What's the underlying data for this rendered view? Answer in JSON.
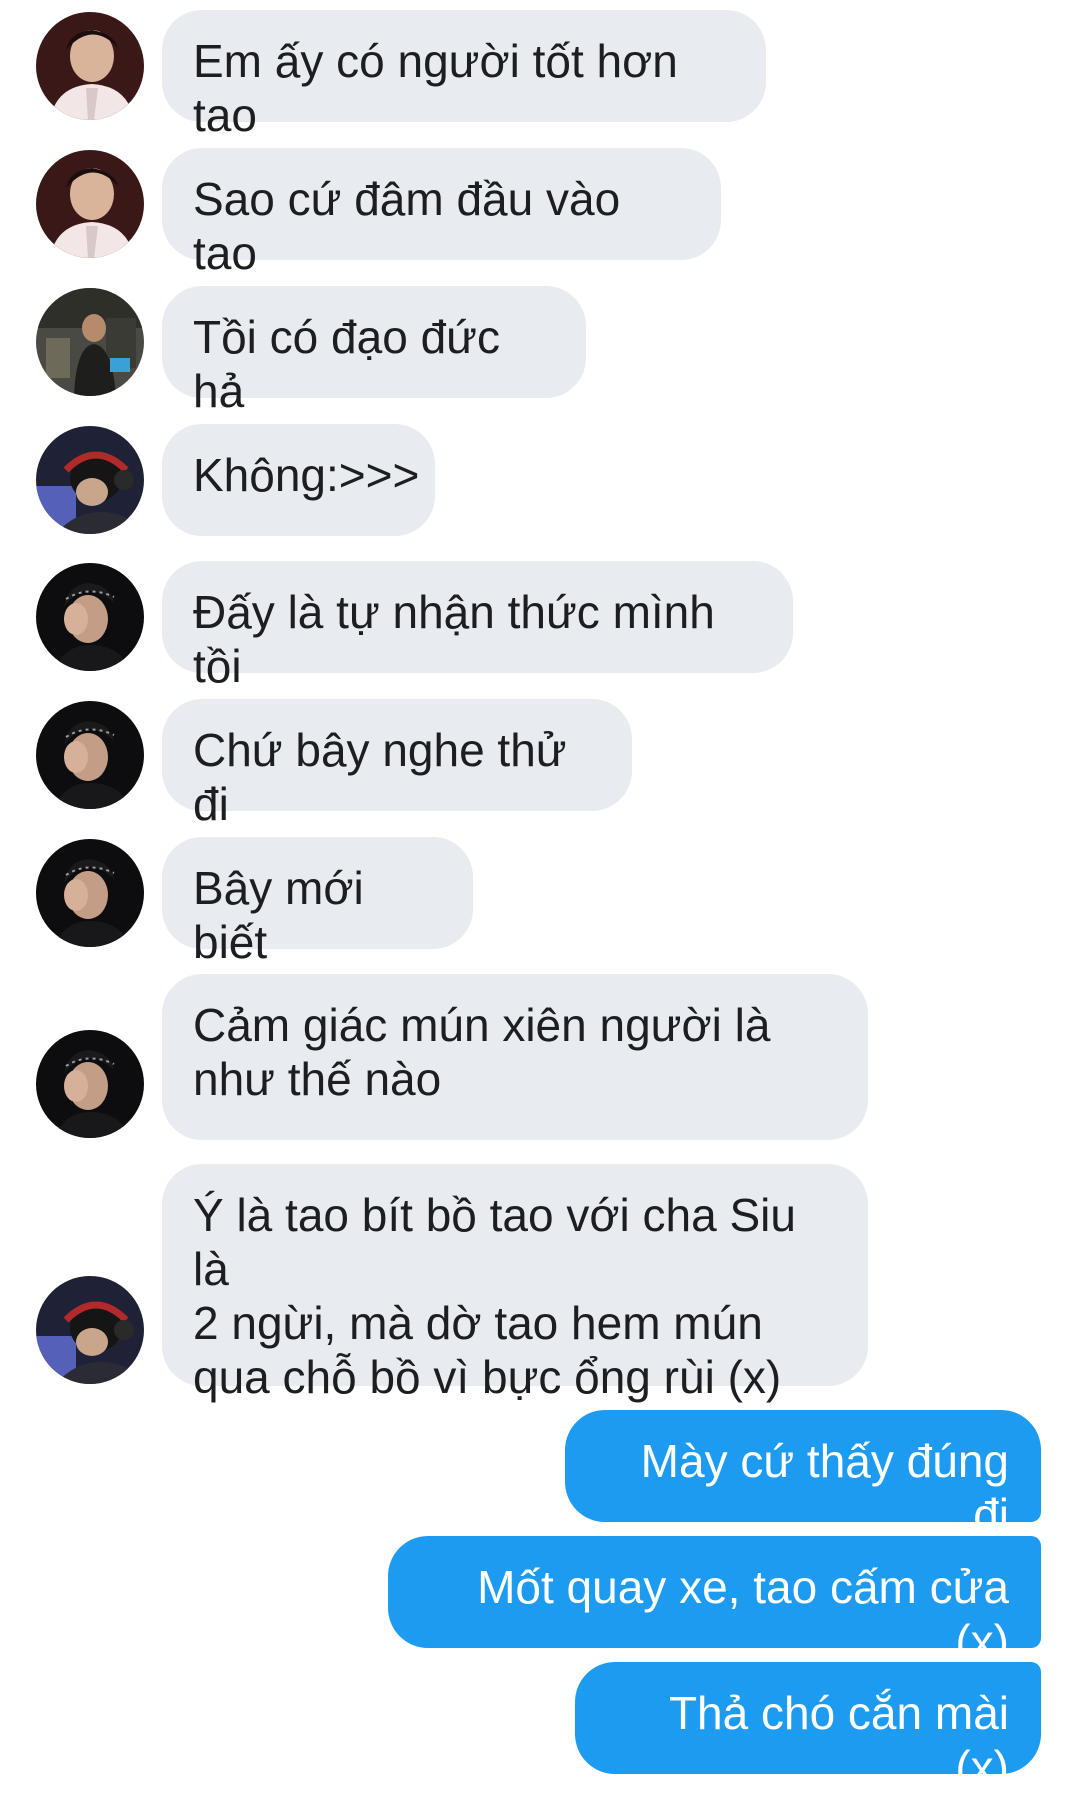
{
  "conversation": {
    "incoming": [
      {
        "text": "Em ấy có người tốt hơn tao",
        "avatar": "avatar-red-jacket-icon"
      },
      {
        "text": "Sao cứ đâm đầu vào tao",
        "avatar": "avatar-red-jacket-icon"
      },
      {
        "text": "Tồi có đạo đức hả",
        "avatar": "avatar-studio-icon"
      },
      {
        "text": "Không:>>>",
        "avatar": "avatar-headphones-icon"
      },
      {
        "text": "Đấy là tự nhận thức mình tồi",
        "avatar": "avatar-dark-facepalm-icon"
      },
      {
        "text": "Chứ bây nghe thử đi",
        "avatar": "avatar-dark-facepalm-icon"
      },
      {
        "text": "Bây mới biết",
        "avatar": "avatar-dark-facepalm-icon"
      },
      {
        "text": "Cảm giác mún xiên người là\nnhư thế nào",
        "avatar": "avatar-dark-facepalm-icon"
      },
      {
        "text": "Ý là tao bít bồ tao với cha Siu là\n2 ngừi, mà dờ tao hem mún\nqua chỗ bồ vì bực ổng rùi (x)",
        "avatar": "avatar-headphones-icon"
      }
    ],
    "outgoing": [
      {
        "text": "Mày cứ thấy đúng đi"
      },
      {
        "text": "Mốt quay xe, tao cấm cửa (x)"
      },
      {
        "text": "Thả chó cắn mài (x)"
      }
    ]
  },
  "colors": {
    "incoming_bubble": "#e8ebef",
    "outgoing_bubble": "#1d9bf0",
    "incoming_text": "#1c1e21",
    "outgoing_text": "#ffffff"
  }
}
